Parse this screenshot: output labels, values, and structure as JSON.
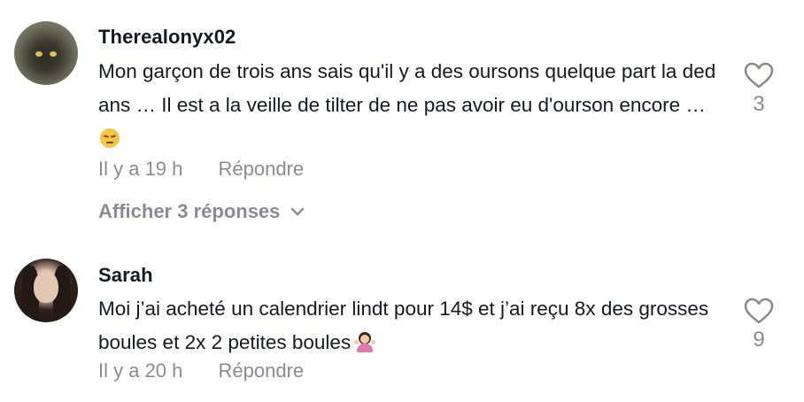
{
  "comments": [
    {
      "username": "Therealonyx02",
      "text": "Mon garçon de trois ans sais qu'il y a des oursons quelque part la dedans … Il est a la veille de tilter de ne pas avoir eu d'ourson encore …",
      "emoji": "pensive-face",
      "time": "Il y a 19 h",
      "reply_label": "Répondre",
      "likes": "3",
      "view_replies": "Afficher 3 réponses",
      "avatar": "black-cat"
    },
    {
      "username": "Sarah",
      "text": "Moi j’ai acheté un calendrier lindt pour 14$ et j’ai reçu 8x des grosses boules et 2x 2 petites boules",
      "emoji": "woman-shrugging",
      "time": "Il y a 20 h",
      "reply_label": "Répondre",
      "likes": "9",
      "avatar": "woman-portrait"
    }
  ],
  "icons": {
    "like": "heart-outline-icon",
    "expand": "chevron-down-icon"
  },
  "colors": {
    "text_primary": "#161823",
    "text_secondary": "#8a8b91"
  }
}
